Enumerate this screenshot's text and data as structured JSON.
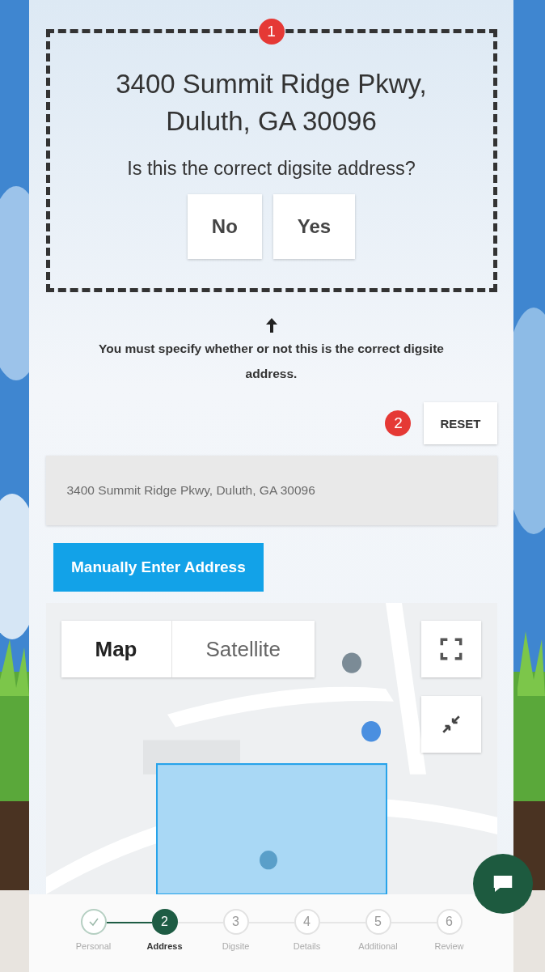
{
  "confirm": {
    "badge": "1",
    "address_lines": [
      "3400 Summit Ridge Pkwy,",
      "Duluth, GA 30096"
    ],
    "question": "Is this the correct digsite address?",
    "buttons": [
      "No",
      "Yes"
    ]
  },
  "hint": {
    "message": "You must specify whether or not this is the correct digsite address."
  },
  "reset": {
    "badge": "2",
    "label": "RESET"
  },
  "address_field": {
    "value": "3400 Summit Ridge Pkwy, Duluth, GA 30096",
    "disabled": true
  },
  "manual_button": {
    "label": "Manually Enter Address"
  },
  "map": {
    "type_tabs": [
      {
        "label": "Map",
        "selected": true
      },
      {
        "label": "Satellite",
        "selected": false
      }
    ]
  },
  "stepper": {
    "steps": [
      {
        "label": "Personal",
        "done": true,
        "selected": false
      },
      {
        "number": "2",
        "label": "Address",
        "done": false,
        "selected": true
      },
      {
        "number": "3",
        "label": "Digsite",
        "done": false,
        "selected": false
      },
      {
        "number": "4",
        "label": "Details",
        "done": false,
        "selected": false
      },
      {
        "number": "5",
        "label": "Additional",
        "done": false,
        "selected": false
      },
      {
        "number": "6",
        "label": "Review",
        "done": false,
        "selected": false
      }
    ]
  }
}
